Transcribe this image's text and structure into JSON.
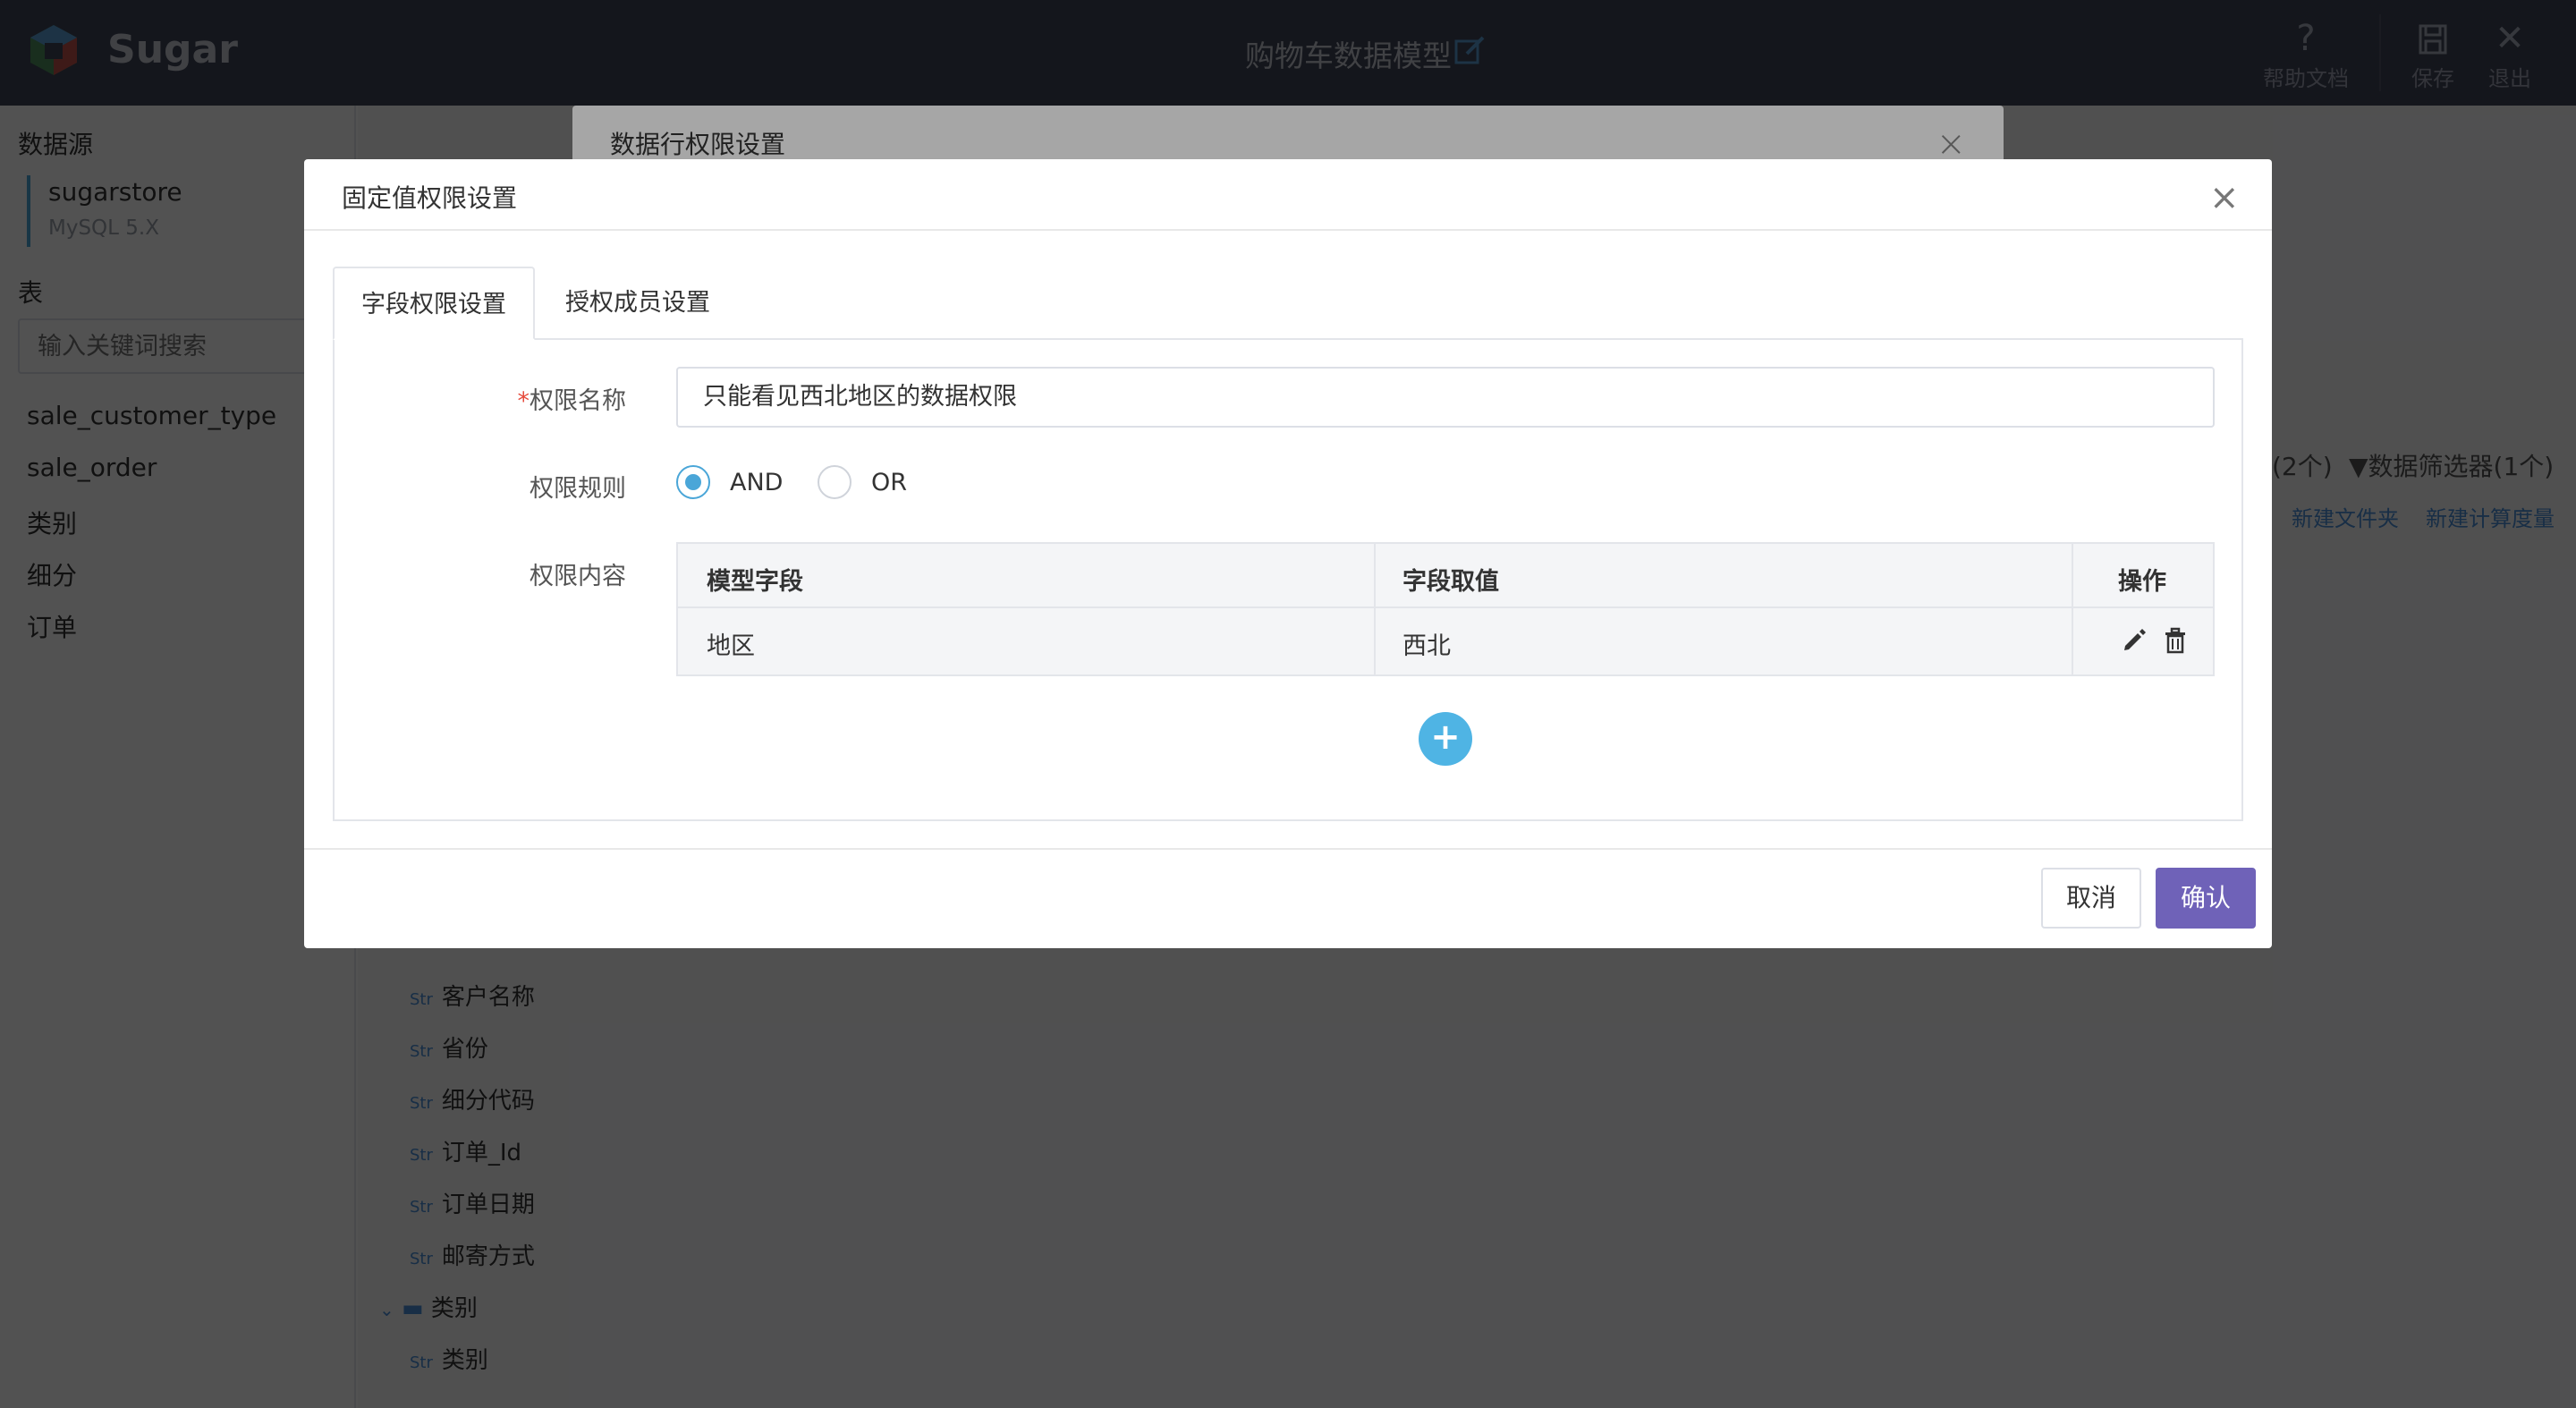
{
  "app": {
    "brand": "Sugar",
    "model_title": "购物车数据模型",
    "toolbar": {
      "help_label": "帮助文档",
      "save_label": "保存",
      "exit_label": "退出"
    }
  },
  "sidebar": {
    "datasource_title": "数据源",
    "datasource_name": "sugarstore",
    "datasource_type": "MySQL 5.X",
    "table_title": "表",
    "search_placeholder": "输入关键词搜索",
    "tables": [
      "sale_customer_type",
      "sale_order",
      "类别",
      "细分",
      "订单"
    ]
  },
  "background": {
    "filter_count": "(2个)",
    "filter_label": "数据筛选器(1个)",
    "new_folder": "新建文件夹",
    "new_measure": "新建计算度量",
    "fields": [
      "客户名称",
      "省份",
      "细分代码",
      "订单_Id",
      "订单日期",
      "邮寄方式"
    ],
    "field_type": "Str",
    "folder_name": "类别",
    "folder_field": "类别"
  },
  "back_dialog": {
    "title": "数据行权限设置"
  },
  "dialog": {
    "title": "固定值权限设置",
    "tabs": [
      "字段权限设置",
      "授权成员设置"
    ],
    "name_label": "权限名称",
    "name_value": "只能看见西北地区的数据权限",
    "rule_label": "权限规则",
    "rule_options": [
      "AND",
      "OR"
    ],
    "rule_selected": "AND",
    "content_label": "权限内容",
    "table_headers": [
      "模型字段",
      "字段取值",
      "操作"
    ],
    "rows": [
      {
        "field": "地区",
        "value": "西北"
      }
    ],
    "cancel_label": "取消",
    "ok_label": "确认"
  },
  "colors": {
    "topbar": "#3f4458",
    "accent_blue": "#4aa6d8",
    "primary_button": "#6f62b8"
  }
}
